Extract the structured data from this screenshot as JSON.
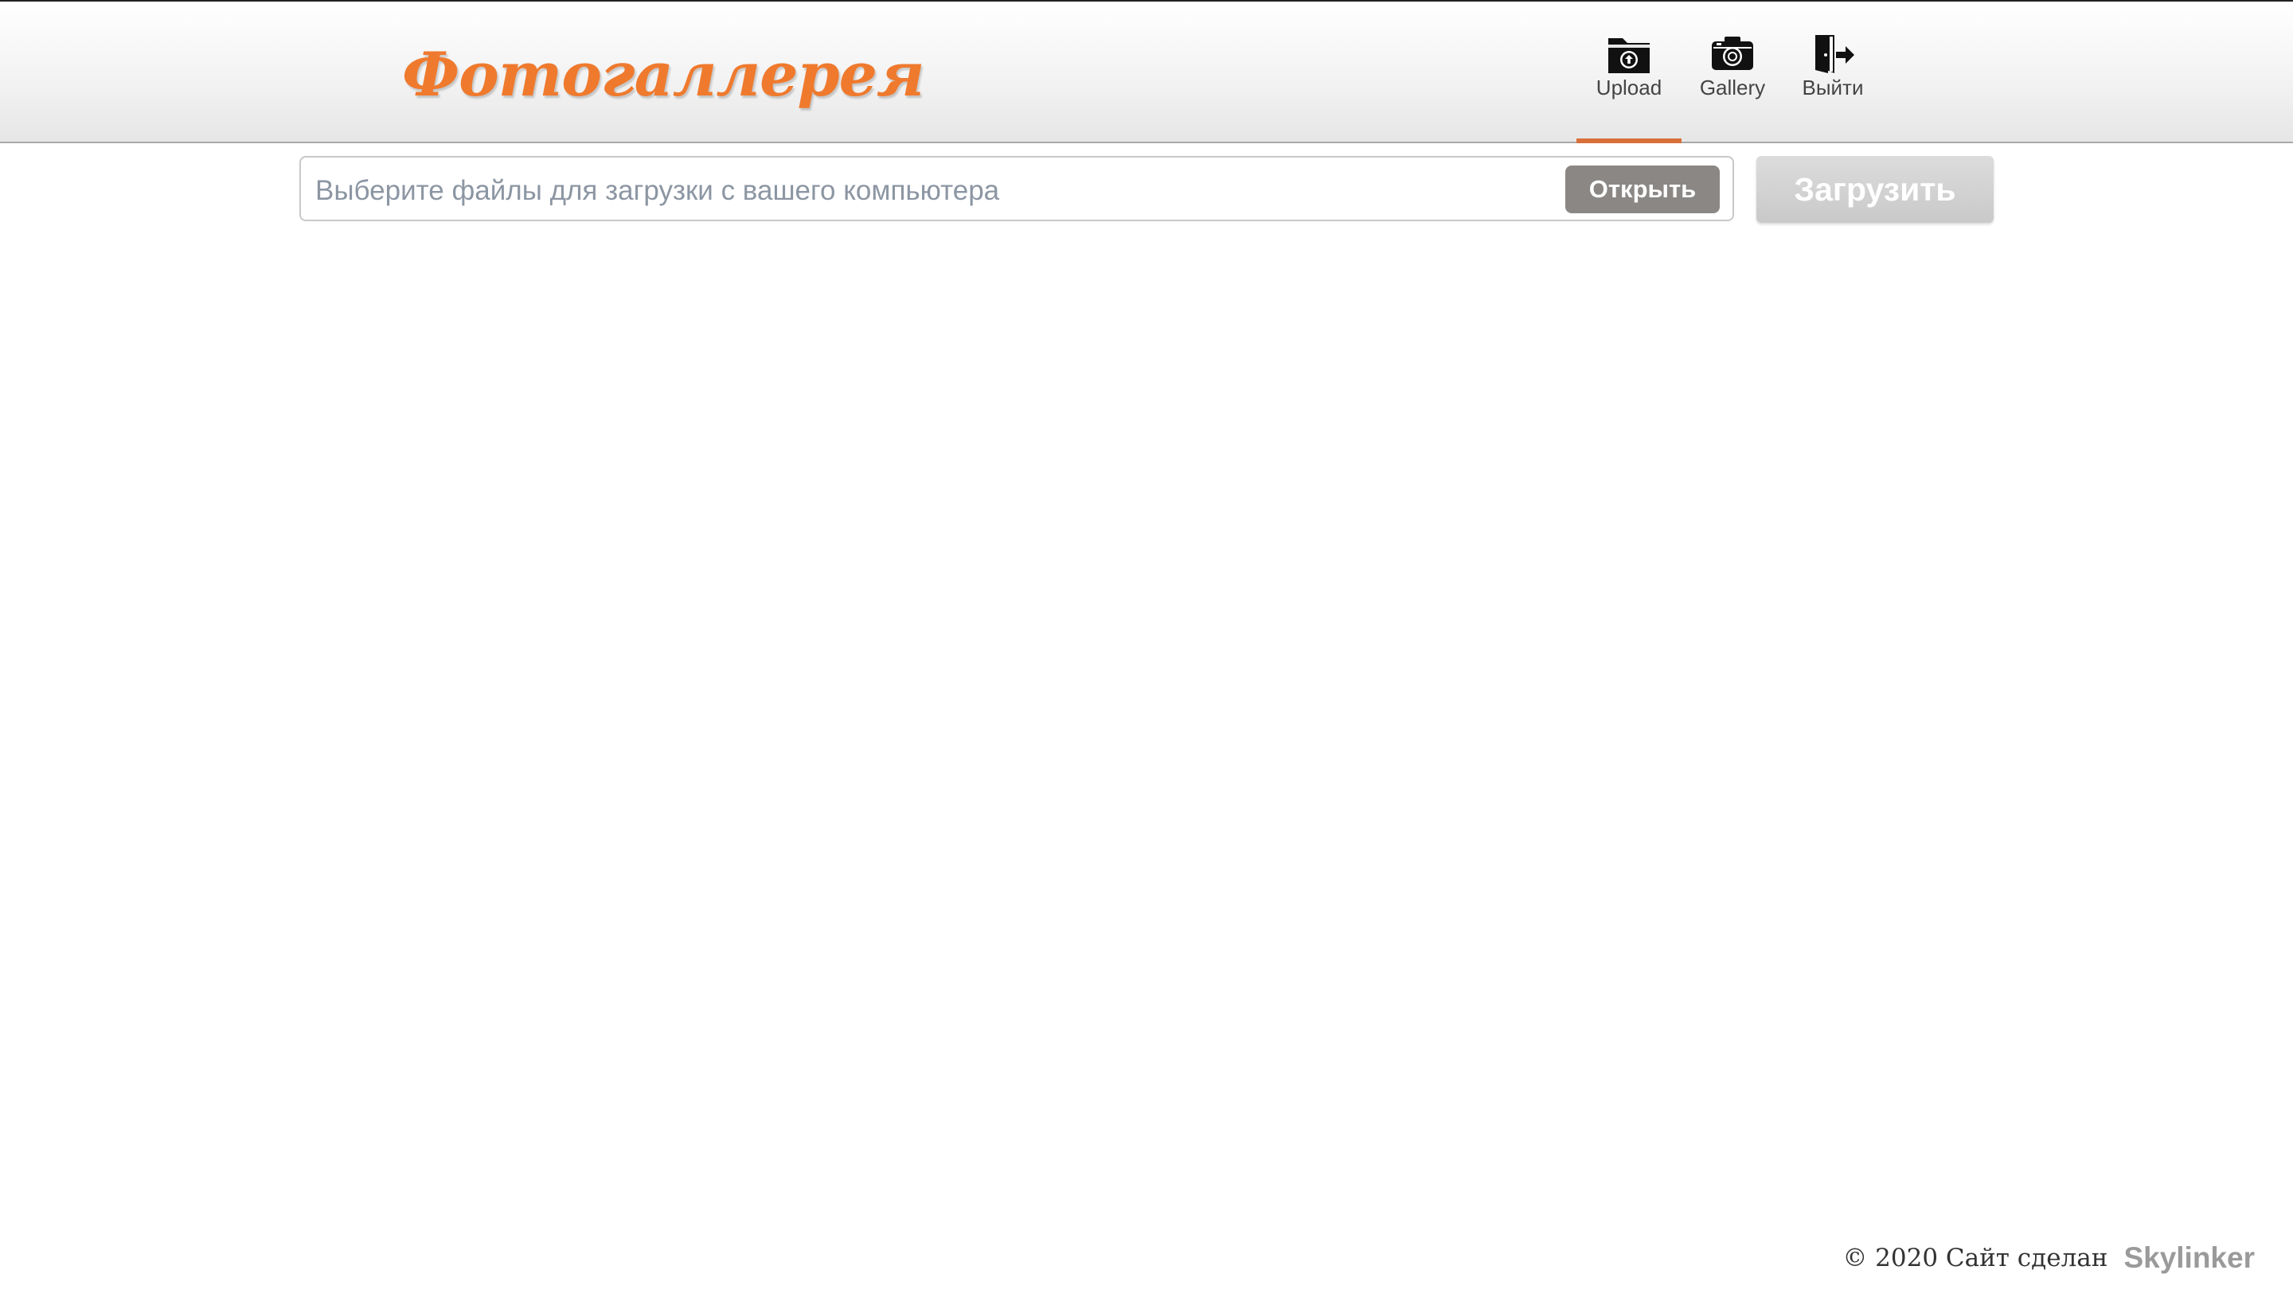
{
  "header": {
    "logo_text": "Фотогаллерея",
    "nav": [
      {
        "label": "Upload",
        "icon": "folder-upload-icon",
        "active": true
      },
      {
        "label": "Gallery",
        "icon": "camera-icon",
        "active": false
      },
      {
        "label": "Выйти",
        "icon": "exit-door-icon",
        "active": false
      }
    ],
    "active_accent_color": "#d9703a",
    "logo_color": "#ef7a2e"
  },
  "upload_form": {
    "file_placeholder": "Выберите файлы для загрузки с вашего компьютера",
    "open_button_label": "Открыть",
    "submit_button_label": "Загрузить"
  },
  "footer": {
    "copyright_text": "© 2020 Сайт сделан",
    "brand_text": "Skylinker"
  }
}
